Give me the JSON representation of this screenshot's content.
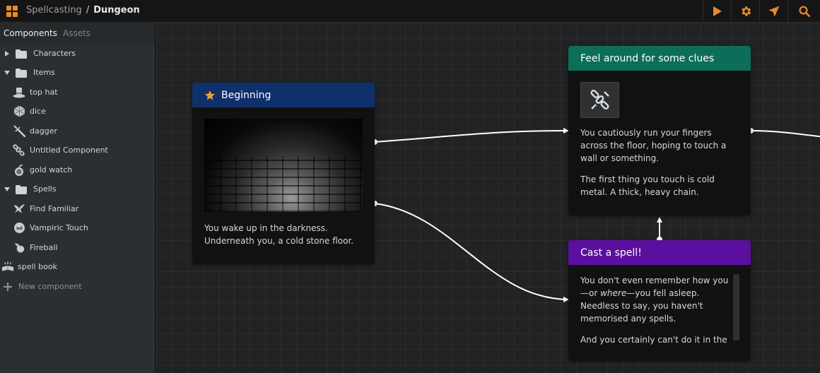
{
  "colors": {
    "accent": "#e88a2a",
    "beginning_header": "#10306b",
    "clues_header": "#0c6e58",
    "spell_header": "#5b0f9e"
  },
  "header": {
    "breadcrumb_project": "Spellcasting",
    "breadcrumb_separator": "/",
    "breadcrumb_current": "Dungeon",
    "toolbar_icons": [
      "play-icon",
      "gear-icon",
      "send-icon",
      "search-icon"
    ]
  },
  "sidebar": {
    "tabs": [
      "Components",
      "Assets"
    ],
    "tree": {
      "characters": "Characters",
      "items": "Items",
      "top_hat": "top hat",
      "dice": "dice",
      "dagger": "dagger",
      "untitled": "Untitled Component",
      "gold_watch": "gold watch",
      "spells": "Spells",
      "find_familiar": "Find Familiar",
      "vampiric_touch": "Vampiric Touch",
      "fireball": "Fireball",
      "spell_book": "spell book",
      "new_component": "New component"
    }
  },
  "cards": {
    "beginning": {
      "title": "Beginning",
      "text": "You wake up in the darkness. Underneath you, a cold stone floor."
    },
    "clues": {
      "title": "Feel around for some clues",
      "p1": "You cautiously run your fingers across the floor, hoping to touch a wall or something.",
      "p2": "The first thing you touch is cold metal. A thick, heavy chain."
    },
    "spell": {
      "title": "Cast a spell!",
      "p1_a": "You don't even remember how you—or ",
      "p1_em": "where",
      "p1_b": "—you fell asleep. Needless to say, you haven't memorised any spells.",
      "p2": "And you certainly can't do it in the"
    }
  }
}
